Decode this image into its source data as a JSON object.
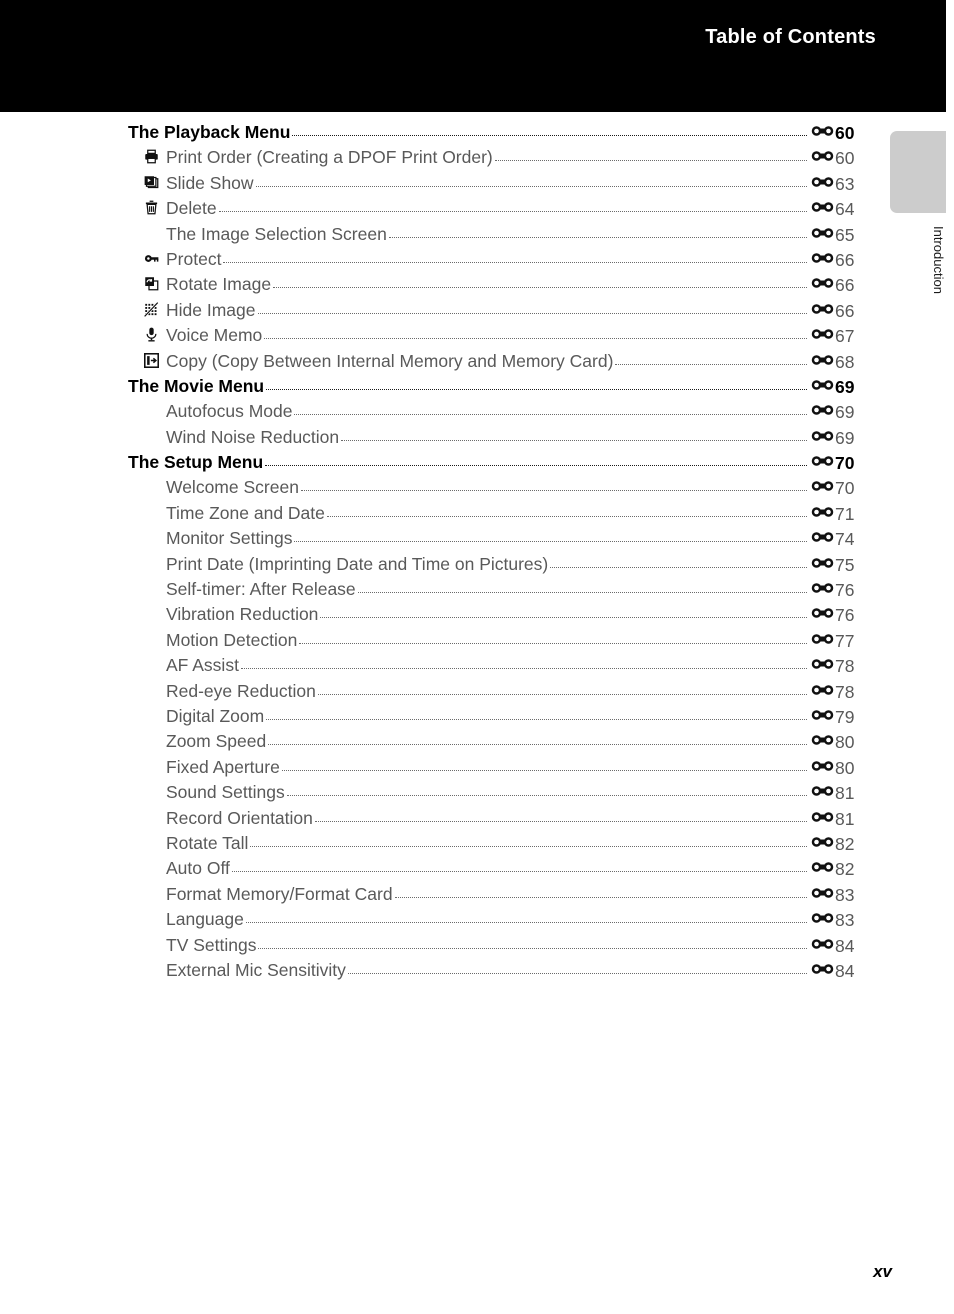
{
  "header": {
    "title": "Table of Contents",
    "background_color": "#000000",
    "text_color": "#ffffff"
  },
  "side_tab": {
    "label": "Introduction",
    "block_color": "#cccccc"
  },
  "footer": {
    "page_folio": "xv"
  },
  "page_ref_icon": "dumbbell-page-reference-icon",
  "toc": {
    "entries": [
      {
        "level": "head",
        "icon": null,
        "title": "The Playback Menu",
        "page": "60"
      },
      {
        "level": "sub",
        "icon": "printer-icon",
        "title": "Print Order (Creating a DPOF Print Order)",
        "page": "60"
      },
      {
        "level": "sub",
        "icon": "slideshow-icon",
        "title": "Slide Show",
        "page": "63"
      },
      {
        "level": "sub",
        "icon": "trash-icon",
        "title": "Delete",
        "page": "64"
      },
      {
        "level": "sub",
        "icon": null,
        "title": "The Image Selection Screen",
        "page": "65"
      },
      {
        "level": "sub",
        "icon": "key-icon",
        "title": "Protect",
        "page": "66"
      },
      {
        "level": "sub",
        "icon": "rotate-image-icon",
        "title": "Rotate Image",
        "page": "66"
      },
      {
        "level": "sub",
        "icon": "hide-image-icon",
        "title": "Hide Image",
        "page": "66"
      },
      {
        "level": "sub",
        "icon": "microphone-icon",
        "title": "Voice Memo",
        "page": "67"
      },
      {
        "level": "sub",
        "icon": "copy-icon",
        "title": "Copy (Copy Between Internal Memory and Memory Card)",
        "page": "68"
      },
      {
        "level": "head",
        "icon": null,
        "title": "The Movie Menu",
        "page": "69"
      },
      {
        "level": "sub",
        "icon": null,
        "title": "Autofocus Mode",
        "page": "69"
      },
      {
        "level": "sub",
        "icon": null,
        "title": "Wind Noise Reduction",
        "page": "69"
      },
      {
        "level": "head",
        "icon": null,
        "title": "The Setup Menu",
        "page": "70"
      },
      {
        "level": "sub",
        "icon": null,
        "title": "Welcome Screen",
        "page": "70"
      },
      {
        "level": "sub",
        "icon": null,
        "title": "Time Zone and Date",
        "page": "71"
      },
      {
        "level": "sub",
        "icon": null,
        "title": "Monitor Settings",
        "page": "74"
      },
      {
        "level": "sub",
        "icon": null,
        "title": "Print Date (Imprinting Date and Time on Pictures)",
        "page": "75"
      },
      {
        "level": "sub",
        "icon": null,
        "title": "Self-timer: After Release",
        "page": "76"
      },
      {
        "level": "sub",
        "icon": null,
        "title": "Vibration Reduction",
        "page": "76"
      },
      {
        "level": "sub",
        "icon": null,
        "title": "Motion Detection",
        "page": "77"
      },
      {
        "level": "sub",
        "icon": null,
        "title": "AF Assist",
        "page": "78"
      },
      {
        "level": "sub",
        "icon": null,
        "title": "Red-eye Reduction",
        "page": "78"
      },
      {
        "level": "sub",
        "icon": null,
        "title": "Digital Zoom",
        "page": "79"
      },
      {
        "level": "sub",
        "icon": null,
        "title": "Zoom Speed",
        "page": "80"
      },
      {
        "level": "sub",
        "icon": null,
        "title": "Fixed Aperture",
        "page": "80"
      },
      {
        "level": "sub",
        "icon": null,
        "title": "Sound Settings",
        "page": "81"
      },
      {
        "level": "sub",
        "icon": null,
        "title": "Record Orientation",
        "page": "81"
      },
      {
        "level": "sub",
        "icon": null,
        "title": "Rotate Tall",
        "page": "82"
      },
      {
        "level": "sub",
        "icon": null,
        "title": "Auto Off",
        "page": "82"
      },
      {
        "level": "sub",
        "icon": null,
        "title": "Format Memory/Format Card",
        "page": "83"
      },
      {
        "level": "sub",
        "icon": null,
        "title": "Language",
        "page": "83"
      },
      {
        "level": "sub",
        "icon": null,
        "title": "TV Settings",
        "page": "84"
      },
      {
        "level": "sub",
        "icon": null,
        "title": "External Mic Sensitivity",
        "page": "84"
      }
    ]
  }
}
